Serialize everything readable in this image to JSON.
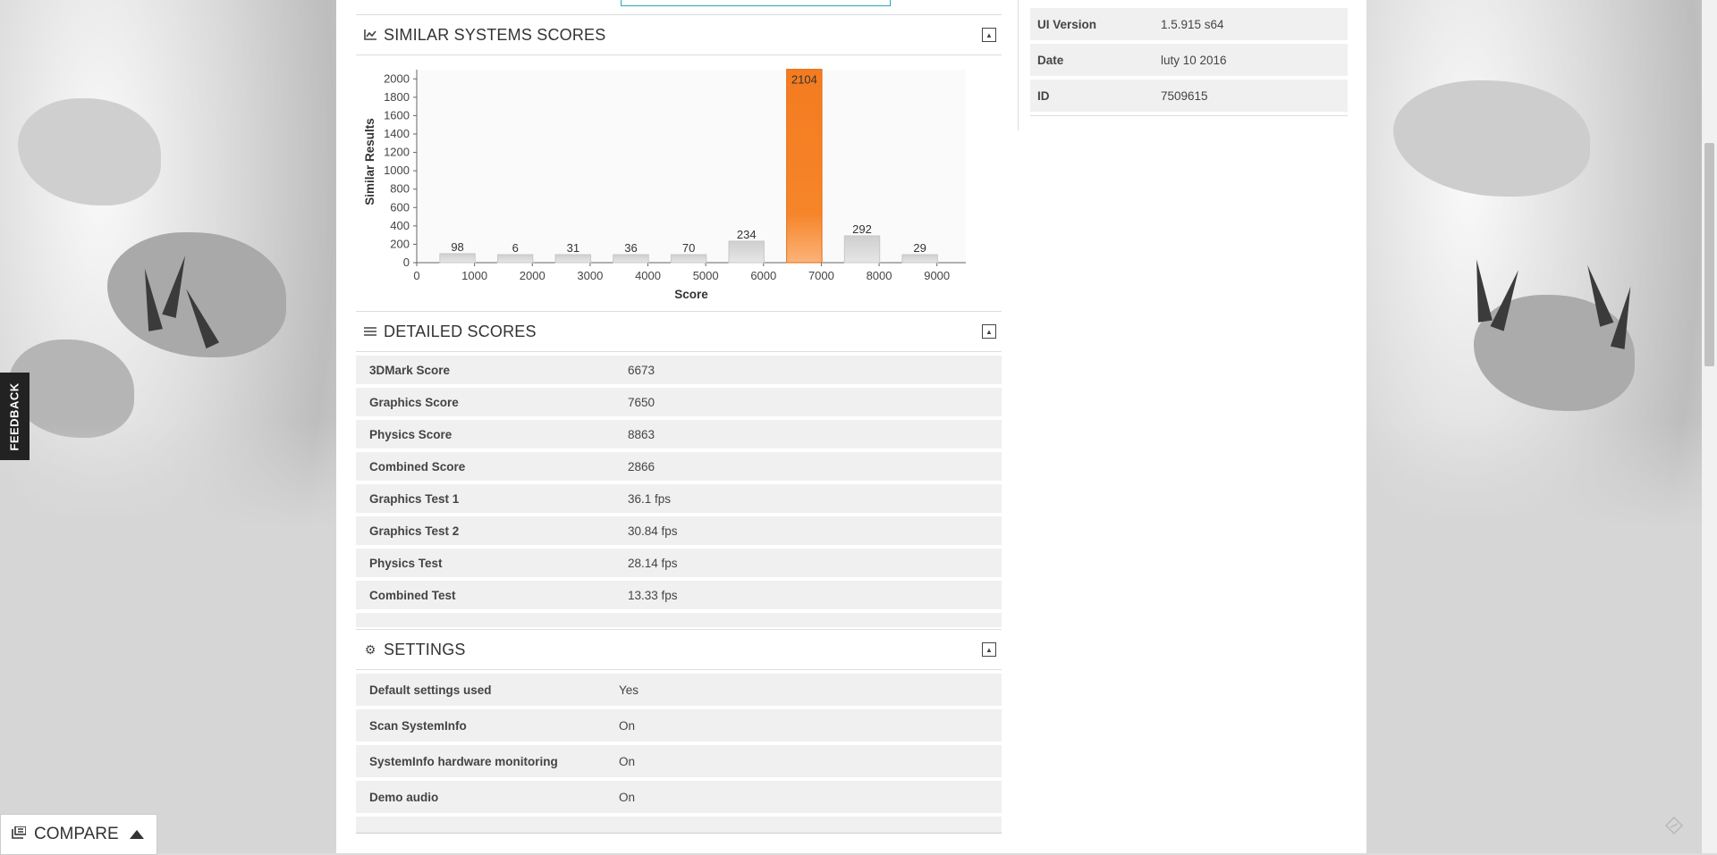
{
  "side_info": [
    {
      "label": "UI Version",
      "value": "1.5.915 s64"
    },
    {
      "label": "Date",
      "value": "luty 10 2016"
    },
    {
      "label": "ID",
      "value": "7509615"
    }
  ],
  "panels": {
    "similar": {
      "title": "SIMILAR SYSTEMS SCORES",
      "icon": "line-chart-icon"
    },
    "detailed": {
      "title": "DETAILED SCORES",
      "icon": "list-icon"
    },
    "settings": {
      "title": "SETTINGS",
      "icon": "gear-icon"
    }
  },
  "detailed_scores": [
    {
      "label": "3DMark Score",
      "value": "6673"
    },
    {
      "label": "Graphics Score",
      "value": "7650"
    },
    {
      "label": "Physics Score",
      "value": "8863"
    },
    {
      "label": "Combined Score",
      "value": "2866"
    },
    {
      "label": "Graphics Test 1",
      "value": "36.1 fps"
    },
    {
      "label": "Graphics Test 2",
      "value": "30.84 fps"
    },
    {
      "label": "Physics Test",
      "value": "28.14 fps"
    },
    {
      "label": "Combined Test",
      "value": "13.33 fps"
    }
  ],
  "settings": [
    {
      "label": "Default settings used",
      "value": "Yes"
    },
    {
      "label": "Scan SystemInfo",
      "value": "On"
    },
    {
      "label": "SystemInfo hardware monitoring",
      "value": "On"
    },
    {
      "label": "Demo audio",
      "value": "On"
    }
  ],
  "feedback_label": "FEEDBACK",
  "compare_label": "COMPARE",
  "colors": {
    "accent": "#f47b20",
    "bar_gray": "#d9d9d9",
    "search_border": "#27a9b5"
  },
  "chart_data": {
    "type": "bar",
    "title": "",
    "xlabel": "Score",
    "ylabel": "Similar Results",
    "xlim": [
      0,
      9500
    ],
    "ylim": [
      0,
      2100
    ],
    "x_ticks": [
      0,
      1000,
      2000,
      3000,
      4000,
      5000,
      6000,
      7000,
      8000,
      9000
    ],
    "y_ticks": [
      0,
      200,
      400,
      600,
      800,
      1000,
      1200,
      1400,
      1600,
      1800,
      2000
    ],
    "bars": [
      {
        "x": 800,
        "value": 98
      },
      {
        "x": 1800,
        "value": 6
      },
      {
        "x": 2800,
        "value": 31
      },
      {
        "x": 3800,
        "value": 36
      },
      {
        "x": 4800,
        "value": 70
      },
      {
        "x": 5800,
        "value": 234
      },
      {
        "x": 6800,
        "value": 2104,
        "highlight": true
      },
      {
        "x": 7800,
        "value": 292
      },
      {
        "x": 8800,
        "value": 29
      }
    ]
  }
}
